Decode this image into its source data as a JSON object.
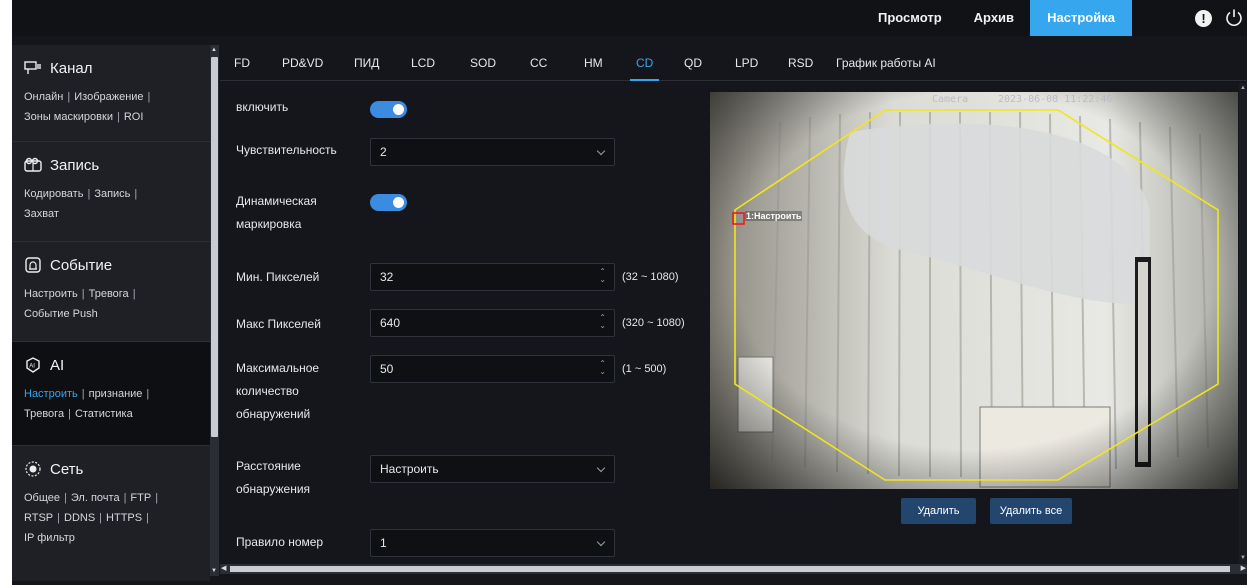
{
  "topbar": {
    "nav": [
      {
        "label": "Просмотр"
      },
      {
        "label": "Архив"
      },
      {
        "label": "Настройка"
      }
    ],
    "active_color": "#36a6ee"
  },
  "sidebar": {
    "sections": [
      {
        "title": "Канал",
        "icon": "channel-icon",
        "links": [
          "Онлайн",
          "Изображение",
          "Зоны маскировки",
          "ROI"
        ]
      },
      {
        "title": "Запись",
        "icon": "record-icon",
        "links": [
          "Кодировать",
          "Запись",
          "Захват"
        ]
      },
      {
        "title": "Событие",
        "icon": "event-icon",
        "links": [
          "Настроить",
          "Тревога",
          "Событие Push"
        ]
      },
      {
        "title": "AI",
        "icon": "ai-icon",
        "links": [
          "Настроить",
          "признание",
          "Тревога",
          "Статистика"
        ]
      },
      {
        "title": "Сеть",
        "icon": "network-icon",
        "links": [
          "Общее",
          "Эл. почта",
          "FTP",
          "RTSP",
          "DDNS",
          "HTTPS",
          "IP фильтр"
        ]
      }
    ]
  },
  "tabs": [
    "FD",
    "PD&VD",
    "ПИД",
    "LCD",
    "SOD",
    "CC",
    "HM",
    "CD",
    "QD",
    "LPD",
    "RSD",
    "График работы AI"
  ],
  "form": {
    "enable_label": "включить",
    "sensitivity_label": "Чувствительность",
    "sensitivity_value": "2",
    "dynamic_marking_label": "Динамическая маркировка",
    "min_pixels_label": "Мин. Пикселей",
    "min_pixels_value": "32",
    "min_pixels_range": "(32 ~ 1080)",
    "max_pixels_label": "Макс Пикселей",
    "max_pixels_value": "640",
    "max_pixels_range": "(320 ~ 1080)",
    "max_detections_label": "Максимальное количество обнаружений",
    "max_detections_value": "50",
    "max_detections_range": "(1 ~ 500)",
    "detection_distance_label": "Расстояние обнаружения",
    "detection_distance_value": "Настроить",
    "rule_number_label": "Правило номер",
    "rule_number_value": "1"
  },
  "preview": {
    "osd_camera": "Camera",
    "osd_datetime": "2023-06-08 11:22:46",
    "zone_label": "1:Настроить",
    "zone_color": "#f0e61c"
  },
  "buttons": {
    "delete": "Удалить",
    "delete_all": "Удалить все"
  }
}
